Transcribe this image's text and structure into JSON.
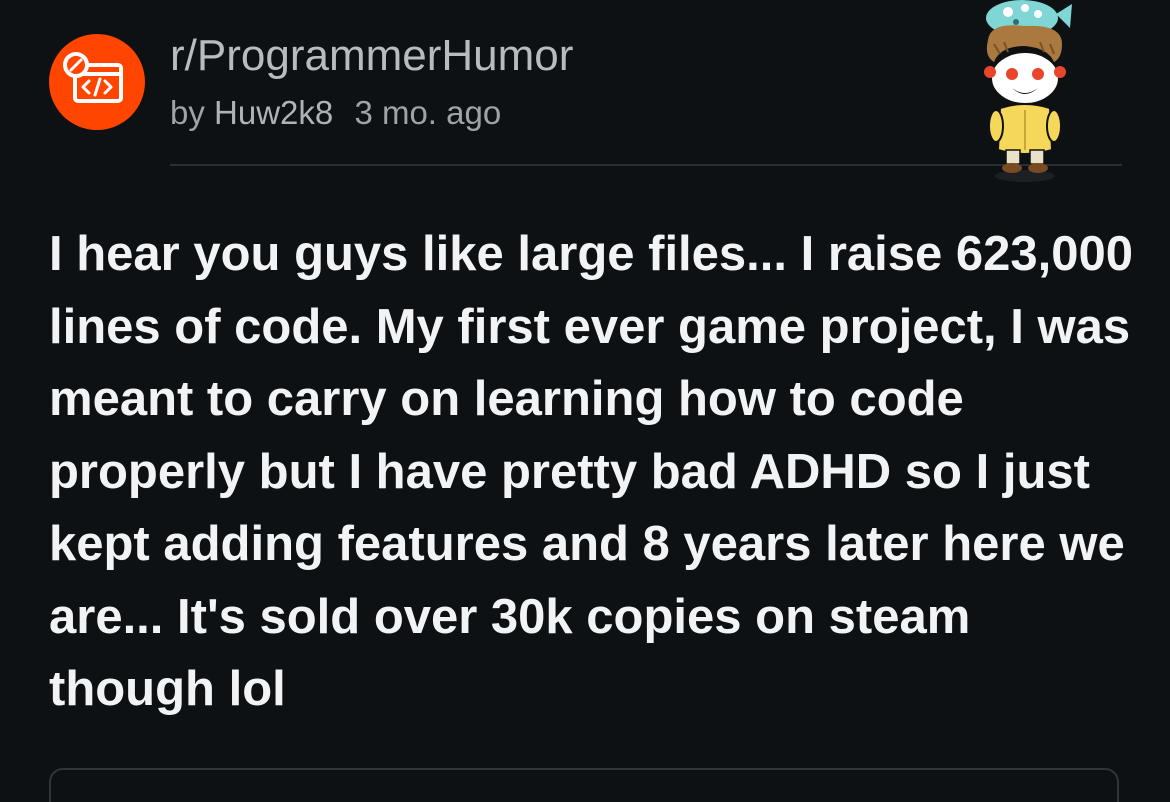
{
  "post": {
    "subreddit": "r/ProgrammerHumor",
    "author_prefix": "by",
    "author": "Huw2k8",
    "age": "3 mo. ago",
    "body": "I hear you guys like large files... I raise 623,000 lines of code. My first ever game project, I was meant to carry on learning how to code properly but I have pretty bad ADHD so I just kept adding features and 8 years later here we are... It's sold over 30k copies on steam though lol"
  },
  "icons": {
    "subreddit": "code-icon",
    "user_avatar": "snoo-avatar-icon"
  },
  "colors": {
    "background": "#0e1113",
    "subreddit_icon": "#ff4500",
    "body_text": "#f2f3f5",
    "meta_text": "#9ea3a8"
  }
}
